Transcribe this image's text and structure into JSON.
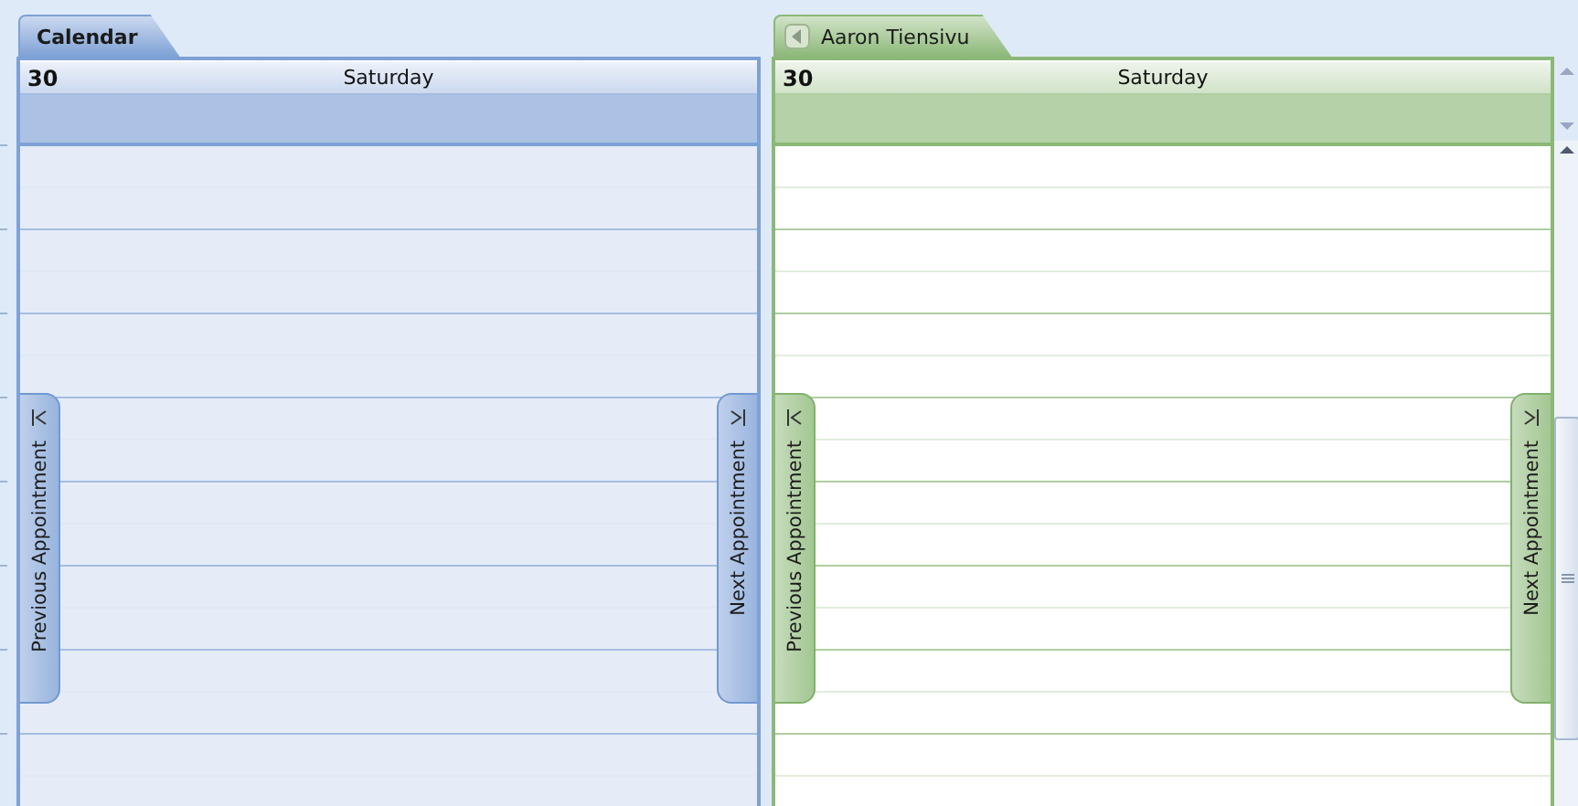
{
  "calendars": [
    {
      "tab": {
        "label": "Calendar"
      },
      "kind": "own",
      "color": "#7ea1d6",
      "day": {
        "number": "30",
        "name": "Saturday"
      },
      "previous": {
        "label": "Previous Appointment"
      },
      "next": {
        "label": "Next Appointment"
      }
    },
    {
      "tab": {
        "label": "Aaron Tiensivu"
      },
      "kind": "shared",
      "color": "#8cb878",
      "day": {
        "number": "30",
        "name": "Saturday"
      },
      "previous": {
        "label": "Previous Appointment"
      },
      "next": {
        "label": "Next Appointment"
      }
    }
  ]
}
